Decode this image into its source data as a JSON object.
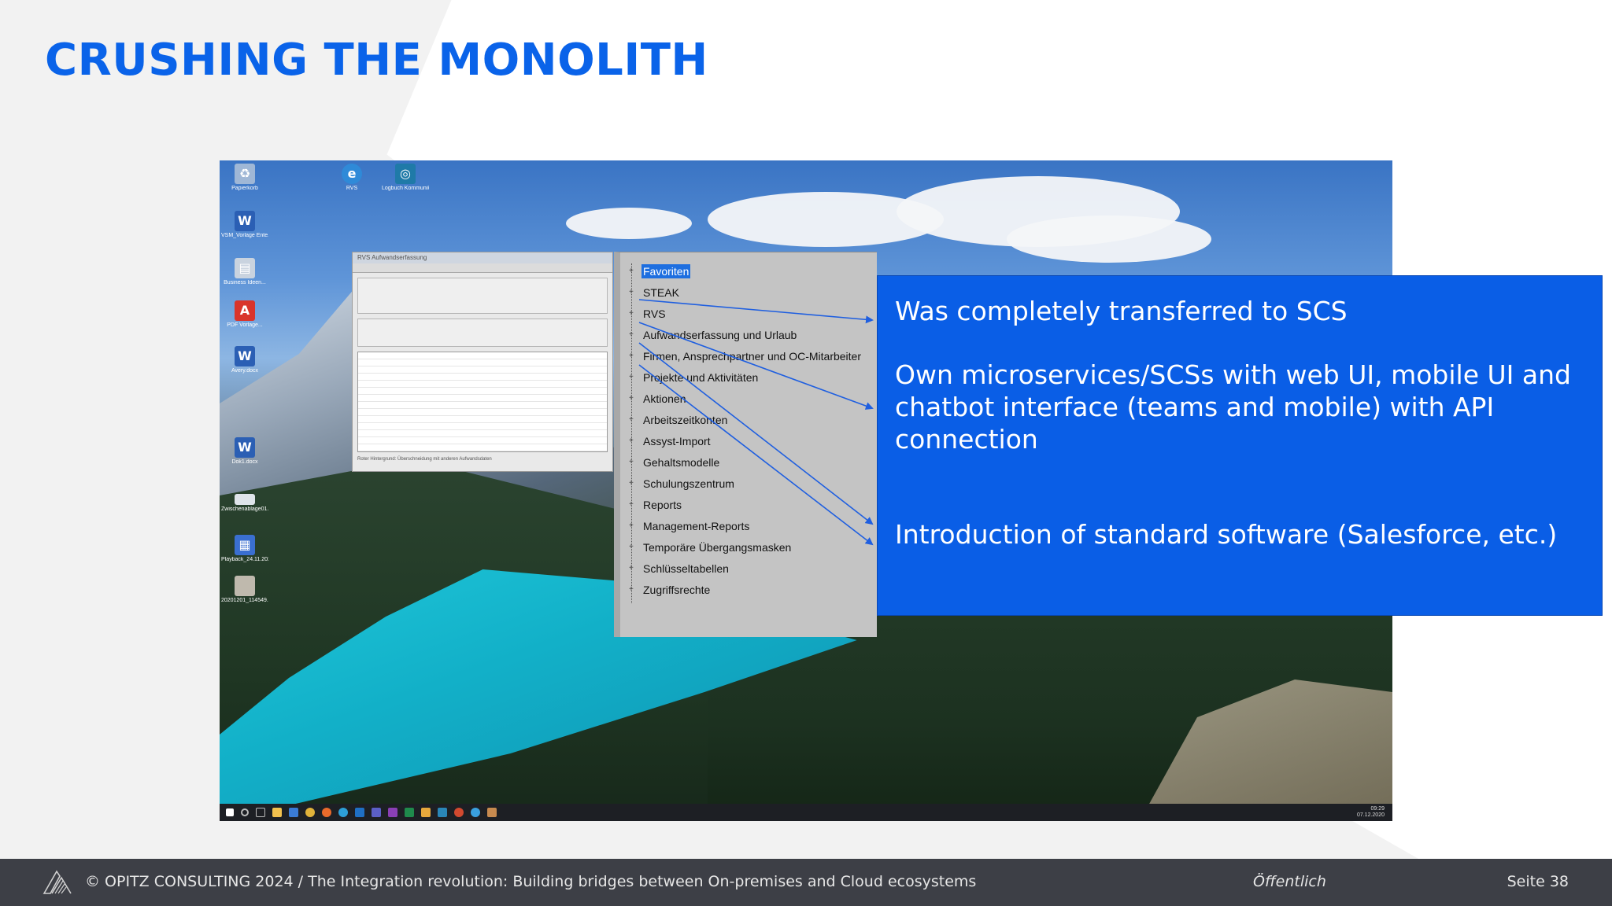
{
  "slide": {
    "title": "CRUSHING THE MONOLITH"
  },
  "desktop": {
    "icons": [
      {
        "label": "Papierkorb",
        "icon": "recycle-bin-icon",
        "color": "#9fb7d6"
      },
      {
        "label": "VSM_Vorlage Ente...",
        "icon": "word-doc-icon",
        "color": "#2b5fb4"
      },
      {
        "label": "Business Ideen...",
        "icon": "document-icon",
        "color": "#c9d3df"
      },
      {
        "label": "PDF Vorlage...",
        "icon": "pdf-icon",
        "color": "#d9342b"
      },
      {
        "label": "Avery.docx",
        "icon": "word-doc-icon",
        "color": "#2b5fb4"
      },
      {
        "label": "Dok1.docx",
        "icon": "word-doc-icon",
        "color": "#2b5fb4"
      },
      {
        "label": "Zwischenablage01...",
        "icon": "image-file-icon",
        "color": "#dfe4ea"
      },
      {
        "label": "Playback_24.11.202...",
        "icon": "media-file-icon",
        "color": "#3a6fd0"
      },
      {
        "label": "20201201_114549...",
        "icon": "image-file-icon",
        "color": "#bfb9ad"
      },
      {
        "label": "RVS",
        "icon": "edge-icon",
        "color": "#2f8ad8"
      },
      {
        "label": "Logbuch Kommunikationsfragen",
        "icon": "app-icon",
        "color": "#1f7aa8"
      }
    ],
    "legacy_window_title": "RVS Aufwandserfassung",
    "legacy_status": "Roter Hintergrund: Überschneidung mit anderen Aufwandsdaten",
    "tree_items": [
      "Favoriten",
      "STEAK",
      "RVS",
      "Aufwandserfassung und Urlaub",
      "Firmen, Ansprechpartner und OC-Mitarbeiter",
      "Projekte und Aktivitäten",
      "Aktionen",
      "Arbeitszeitkonten",
      "Assyst-Import",
      "Gehaltsmodelle",
      "Schulungszentrum",
      "Reports",
      "Management-Reports",
      "Temporäre Übergangsmasken",
      "Schlüsseltabellen",
      "Zugriffsrechte"
    ],
    "tray_time": "09:29",
    "tray_date": "07.12.2020"
  },
  "callout": {
    "line1": "Was completely transferred to SCS",
    "line2": "Own microservices/SCSs with web UI, mobile UI and chatbot interface (teams and mobile) with API connection",
    "line3": "Introduction of standard software (Salesforce, etc.)"
  },
  "footer": {
    "copyright": "© OPITZ CONSULTING 2024  /  The Integration revolution: Building bridges between On-premises and Cloud ecosystems",
    "classification": "Öffentlich",
    "page": "Seite 38"
  },
  "colors": {
    "title_blue": "#0a63e9",
    "callout_blue": "#0a5ee6",
    "footer_bg": "#3d3f46",
    "arrow_blue": "#1f5fe0"
  }
}
